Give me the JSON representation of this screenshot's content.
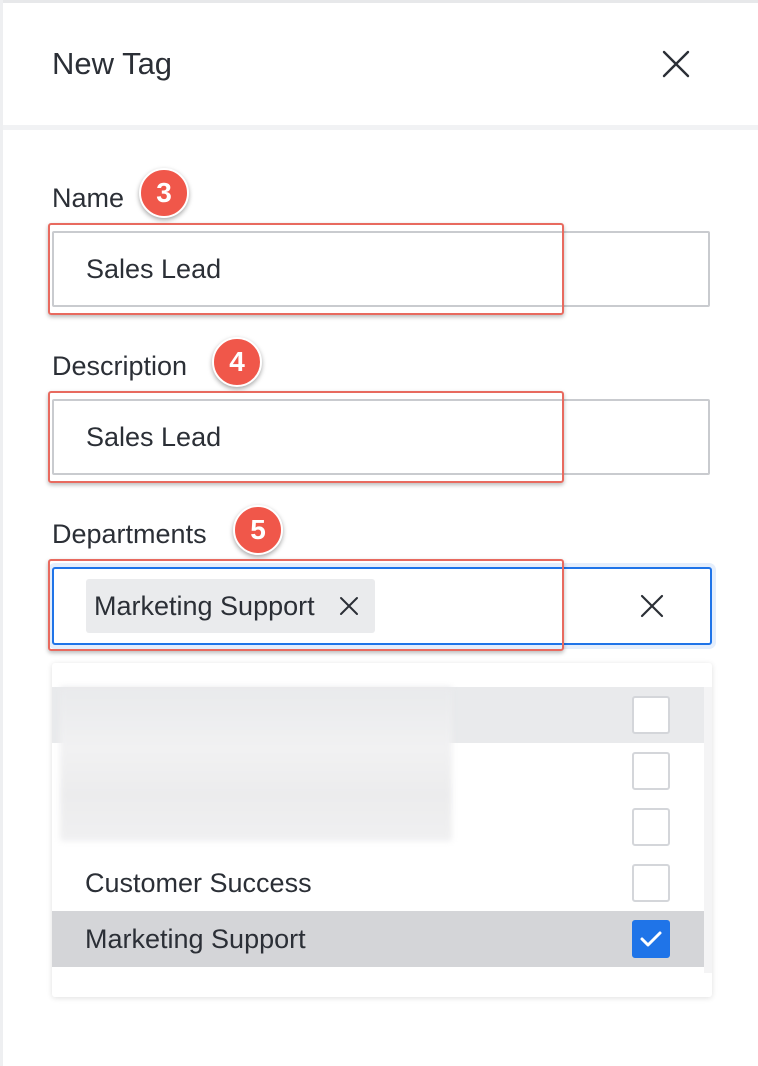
{
  "header": {
    "title": "New Tag"
  },
  "fields": {
    "name": {
      "label": "Name",
      "value": "Sales Lead",
      "step": "3"
    },
    "description": {
      "label": "Description",
      "value": "Sales Lead",
      "step": "4"
    },
    "departments": {
      "label": "Departments",
      "step": "5",
      "selected_chip": "Marketing Support"
    }
  },
  "dropdown": {
    "options": [
      {
        "label": "",
        "checked": false,
        "highlighted": true
      },
      {
        "label": "",
        "checked": false
      },
      {
        "label": "",
        "checked": false
      },
      {
        "label": "Customer Success",
        "checked": false
      },
      {
        "label": "Marketing Support",
        "checked": true,
        "selected": true
      }
    ]
  },
  "colors": {
    "accent": "#1f74e8",
    "badge": "#f0574a",
    "highlight_border": "#e86a5f"
  }
}
